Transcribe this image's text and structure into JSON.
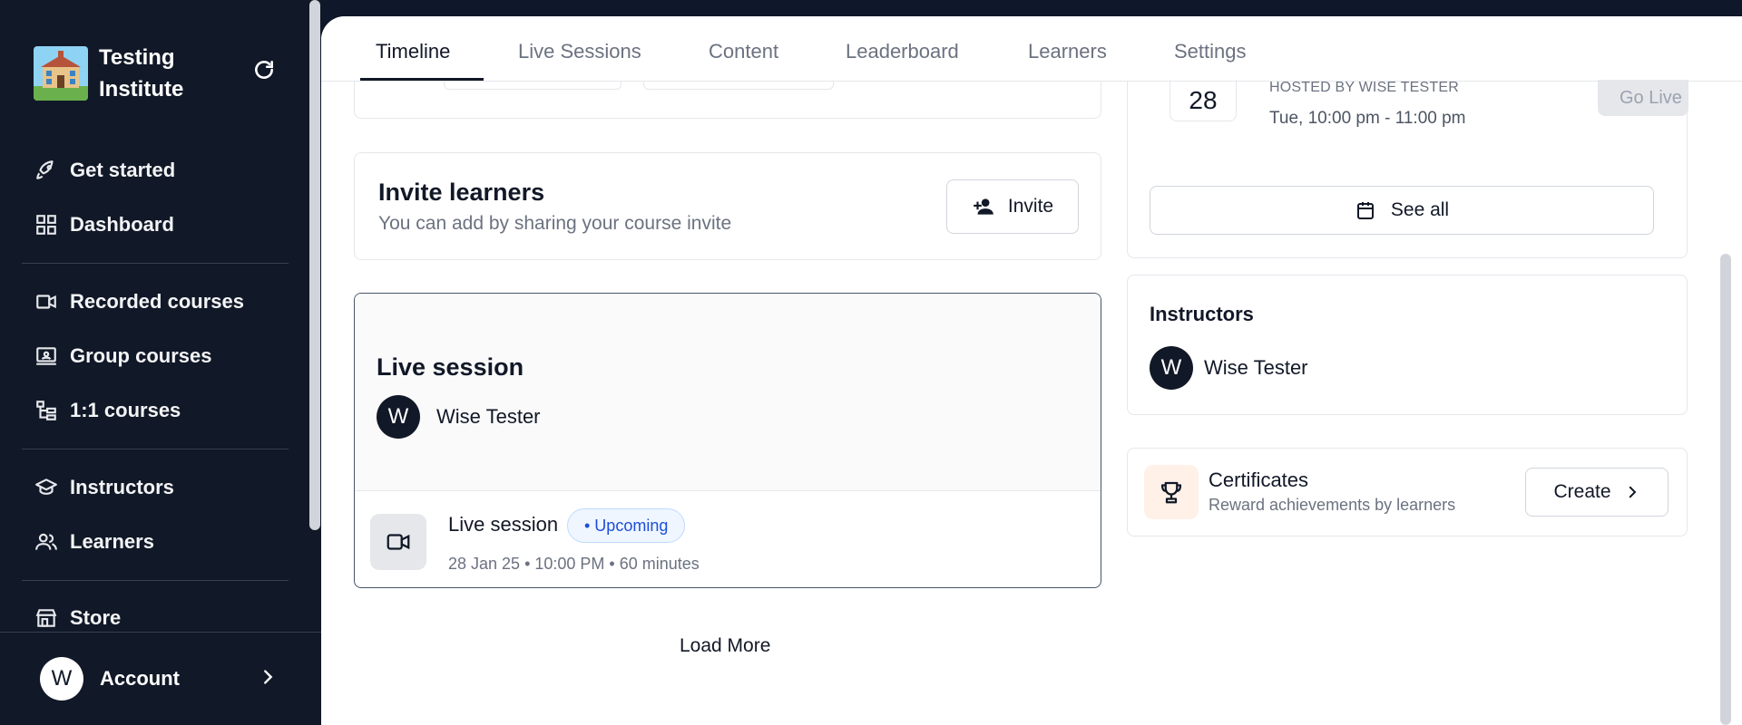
{
  "brand": {
    "name": "Testing Institute",
    "logo_icon": "school-building-logo"
  },
  "nav": {
    "get_started": "Get started",
    "dashboard": "Dashboard",
    "recorded_courses": "Recorded courses",
    "group_courses": "Group courses",
    "one_one_courses": "1:1 courses",
    "instructors": "Instructors",
    "learners": "Learners",
    "store": "Store"
  },
  "account": {
    "initial": "W",
    "label": "Account"
  },
  "tabs": [
    "Timeline",
    "Live Sessions",
    "Content",
    "Leaderboard",
    "Learners",
    "Settings"
  ],
  "invite": {
    "title": "Invite learners",
    "subtitle": "You can add by sharing your course invite",
    "button": "Invite"
  },
  "live_session": {
    "title": "Live session",
    "host_initial": "W",
    "host_name": "Wise Tester",
    "row_title": "Live session",
    "status": "• Upcoming",
    "meta": "28 Jan 25 • 10:00 PM • 60 minutes"
  },
  "load_more": "Load More",
  "upcoming": {
    "day": "28",
    "hosted_by": "HOSTED BY WISE TESTER",
    "time": "Tue, 10:00 pm - 11:00 pm",
    "go_live": "Go Live",
    "see_all": "See all"
  },
  "instructors": {
    "title": "Instructors",
    "initial": "W",
    "name": "Wise Tester"
  },
  "certificates": {
    "title": "Certificates",
    "subtitle": "Reward achievements by learners",
    "button": "Create"
  },
  "colors": {
    "sidebar_bg": "#111827",
    "badge_blue": "#1d4ed8",
    "cert_bg": "#fff1e8"
  }
}
